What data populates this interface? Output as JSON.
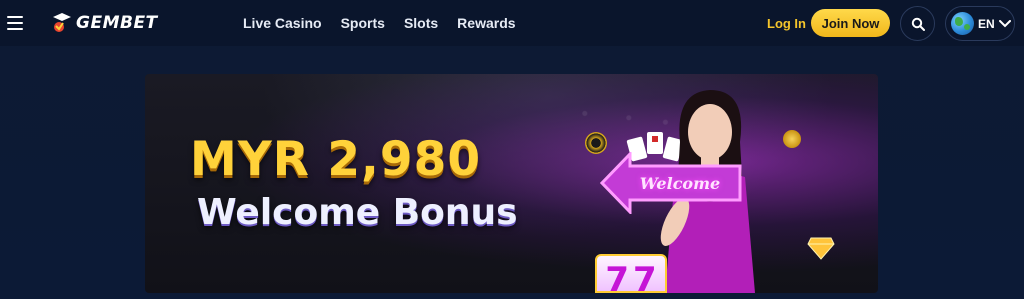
{
  "header": {
    "logo_text": "GEMBET",
    "nav": [
      {
        "label": "Live Casino"
      },
      {
        "label": "Sports"
      },
      {
        "label": "Slots"
      },
      {
        "label": "Rewards"
      }
    ],
    "login_label": "Log In",
    "join_label": "Join Now",
    "language": "EN",
    "icons": {
      "menu": "hamburger-menu-icon",
      "search": "search-icon",
      "globe": "globe-icon",
      "chevron": "chevron-down-icon"
    }
  },
  "banner": {
    "amount": "MYR 2,980",
    "subtitle": "Welcome Bonus",
    "sign_text": "Welcome",
    "slot_symbols": [
      "7",
      "7"
    ]
  },
  "colors": {
    "accent": "#f5c52b",
    "background": "#0d1a33",
    "header": "#0a152c"
  }
}
